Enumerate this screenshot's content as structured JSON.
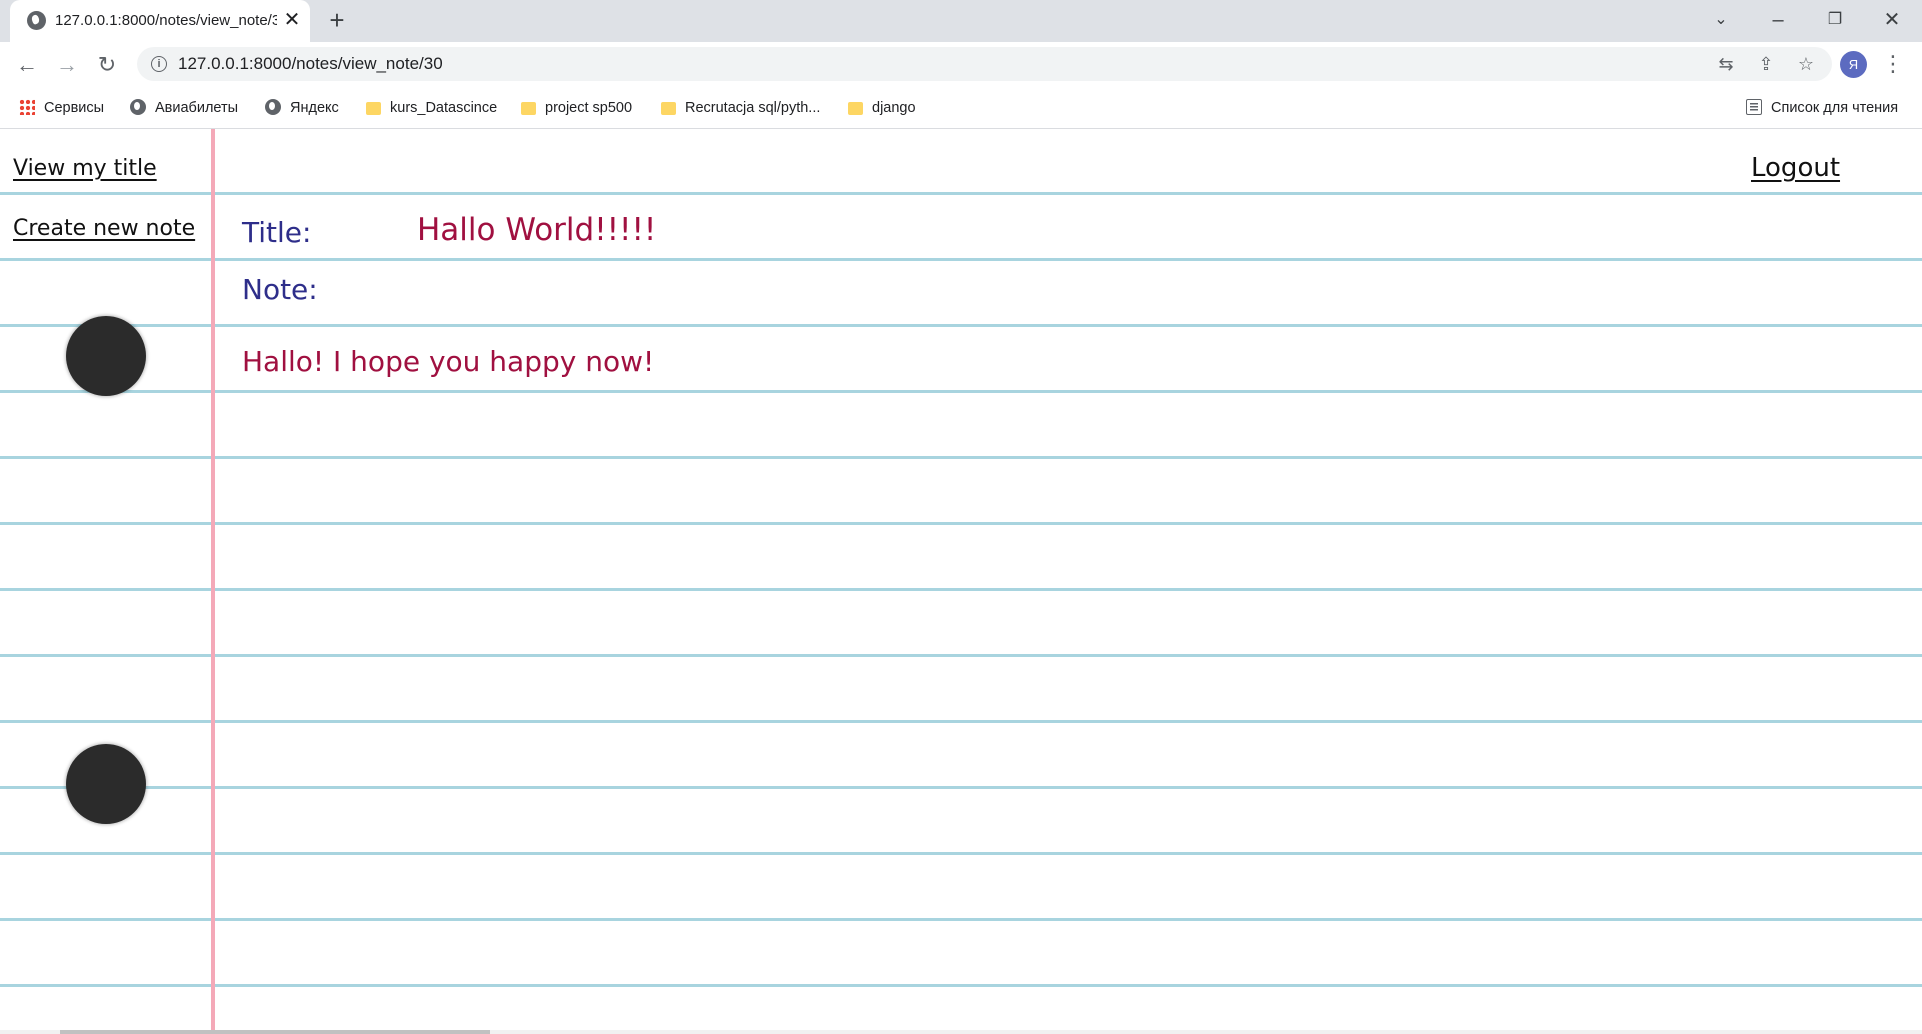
{
  "browser": {
    "tab_title": "127.0.0.1:8000/notes/view_note/30",
    "tab_close": "✕",
    "new_tab": "+",
    "url": "127.0.0.1:8000/notes/view_note/30",
    "profile_initial": "Я",
    "bookmarks": [
      {
        "label": "Сервисы",
        "icon": "apps-icon"
      },
      {
        "label": "Авиабилеты",
        "icon": "globe-icon"
      },
      {
        "label": "Яндекс",
        "icon": "globe-icon"
      },
      {
        "label": "kurs_Datascince",
        "icon": "folder-icon"
      },
      {
        "label": "project sp500",
        "icon": "folder-icon"
      },
      {
        "label": "Recrutacja sql/pyth...",
        "icon": "folder-icon"
      },
      {
        "label": "django",
        "icon": "folder-icon"
      }
    ],
    "reading_list": "Список для чтения"
  },
  "sidebar": {
    "view_title_link": "View my title",
    "create_note_link": "Create new note"
  },
  "header": {
    "logout_link": "Logout"
  },
  "note": {
    "title_label": "Title:",
    "title_value": "Hallo World!!!!!",
    "note_label": "Note:",
    "note_value": "Hallo! I hope you happy now!"
  },
  "colors": {
    "ruled_line": "#a8d4df",
    "margin_line": "#f4a9b8",
    "label_color": "#2e2e8a",
    "value_color": "#a01040"
  }
}
